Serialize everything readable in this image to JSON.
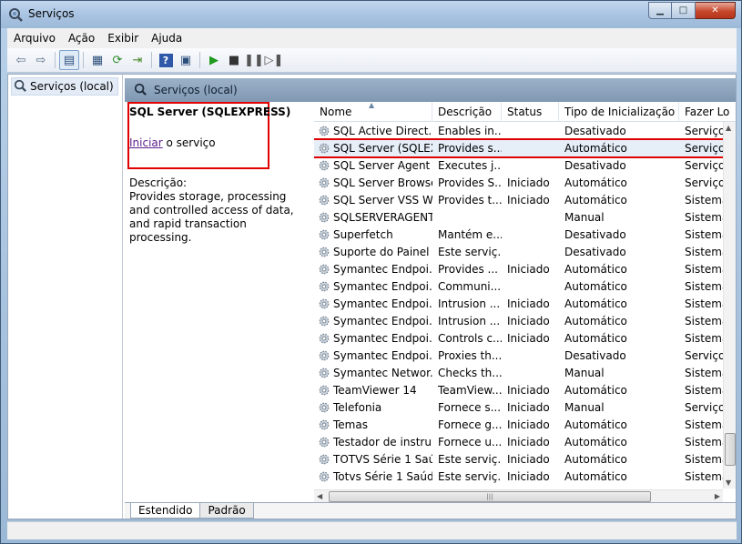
{
  "window": {
    "title": "Serviços"
  },
  "menu": {
    "items": [
      "Arquivo",
      "Ação",
      "Exibir",
      "Ajuda"
    ]
  },
  "toolbar": {
    "icons": [
      "back-arrow-icon",
      "forward-arrow-icon",
      "console-tree-icon",
      "properties-icon",
      "refresh-icon",
      "export-list-icon",
      "help-icon",
      "view-icon",
      "play-icon",
      "stop-icon",
      "pause-icon",
      "restart-icon"
    ]
  },
  "tree": {
    "item_label": "Serviços (local)"
  },
  "pane": {
    "header": "Serviços (local)",
    "service_title": "SQL Server (SQLEXPRESS)",
    "start_link": "Iniciar",
    "start_suffix": " o serviço",
    "desc_label": "Descrição:",
    "desc_text": "Provides storage, processing and controlled access of data, and rapid transaction processing."
  },
  "table": {
    "columns": [
      "Nome",
      "Descrição",
      "Status",
      "Tipo de Inicialização",
      "Fazer Lo"
    ],
    "rows": [
      [
        "SQL Active Direct...",
        "Enables in...",
        "",
        "Desativado",
        "Serviço"
      ],
      [
        "SQL Server (SQLEX...",
        "Provides s...",
        "",
        "Automático",
        "Serviço"
      ],
      [
        "SQL Server Agent ...",
        "Executes j...",
        "",
        "Desativado",
        "Serviço"
      ],
      [
        "SQL Server Browser",
        "Provides S...",
        "Iniciado",
        "Automático",
        "Serviço"
      ],
      [
        "SQL Server VSS Wr...",
        "Provides t...",
        "Iniciado",
        "Automático",
        "Sistema"
      ],
      [
        "SQLSERVERAGENT",
        "",
        "",
        "Manual",
        "Sistema"
      ],
      [
        "Superfetch",
        "Mantém e...",
        "",
        "Desativado",
        "Sistema"
      ],
      [
        "Suporte do Painel ...",
        "Este serviç...",
        "",
        "Desativado",
        "Sistema"
      ],
      [
        "Symantec Endpoi...",
        "Provides ...",
        "Iniciado",
        "Automático",
        "Sistema"
      ],
      [
        "Symantec Endpoi...",
        "Communi...",
        "",
        "Automático",
        "Sistema"
      ],
      [
        "Symantec Endpoi...",
        "Intrusion ...",
        "Iniciado",
        "Automático",
        "Sistema"
      ],
      [
        "Symantec Endpoi...",
        "Intrusion ...",
        "Iniciado",
        "Automático",
        "Sistema"
      ],
      [
        "Symantec Endpoi...",
        "Controls c...",
        "Iniciado",
        "Automático",
        "Sistema"
      ],
      [
        "Symantec Endpoi...",
        "Proxies th...",
        "",
        "Desativado",
        "Serviço"
      ],
      [
        "Symantec Networ...",
        "Checks th...",
        "",
        "Manual",
        "Sistema"
      ],
      [
        "TeamViewer 14",
        "TeamView...",
        "Iniciado",
        "Automático",
        "Sistema"
      ],
      [
        "Telefonia",
        "Fornece s...",
        "Iniciado",
        "Manual",
        "Serviço"
      ],
      [
        "Temas",
        "Fornece g...",
        "Iniciado",
        "Automático",
        "Sistema"
      ],
      [
        "Testador de instru...",
        "Fornece u...",
        "Iniciado",
        "Automático",
        "Sistema"
      ],
      [
        "TOTVS Série 1 Saú...",
        "Este serviç...",
        "Iniciado",
        "Automático",
        "Sistema"
      ],
      [
        "Totvs Série 1 Saúd...",
        "Este serviç...",
        "Iniciado",
        "Automático",
        "Sistema"
      ]
    ],
    "selected_row": 1
  },
  "tabs": [
    "Estendido",
    "Padrão"
  ],
  "colors": {
    "highlight": "#e00000",
    "link": "#5b1e8a",
    "header": "#8aa1b9"
  }
}
